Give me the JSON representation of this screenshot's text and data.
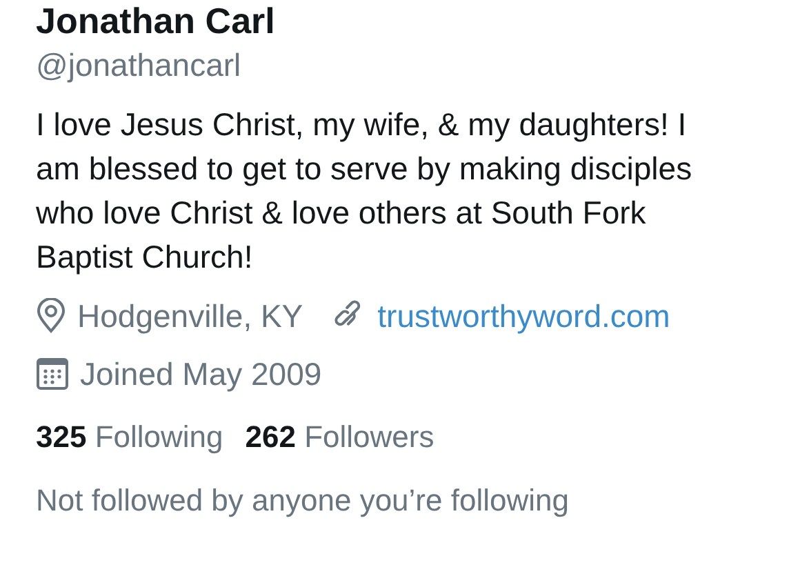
{
  "profile": {
    "name": "Jonathan Carl",
    "handle": "@jonathancarl",
    "bio": "I love Jesus Christ, my wife, & my daughters! I am blessed to get to serve by making disciples who love Christ & love others at South Fork Baptist Church!",
    "location": "Hodgenville, KY",
    "website": "trustworthyword.com",
    "joined": "Joined May 2009"
  },
  "stats": [
    {
      "count": "325",
      "label": "Following"
    },
    {
      "count": "262",
      "label": "Followers"
    }
  ],
  "followed_by": "Not followed by anyone you’re following"
}
